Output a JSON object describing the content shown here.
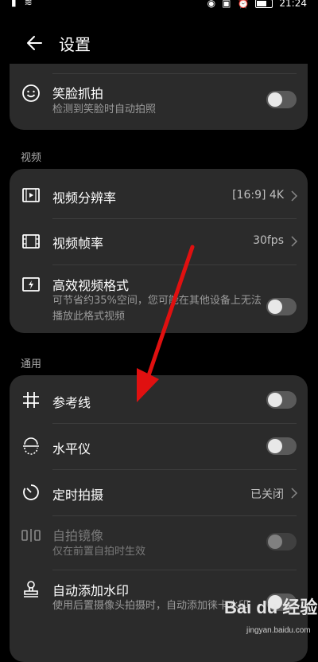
{
  "status_bar": {
    "time": "21:24"
  },
  "header": {
    "title": "设置"
  },
  "top_card": {
    "smile": {
      "label": "笑脸抓拍",
      "sub": "检测到笑脸时自动拍照"
    }
  },
  "sections": {
    "video": "视频",
    "general": "通用"
  },
  "video_card": {
    "resolution": {
      "label": "视频分辨率",
      "value": "[16:9] 4K"
    },
    "fps": {
      "label": "视频帧率",
      "value": "30fps"
    },
    "efficient": {
      "label": "高效视频格式",
      "sub": "可节省约35%空间，您可能在其他设备上无法播放此格式视频"
    }
  },
  "general_card": {
    "gridlines": {
      "label": "参考线"
    },
    "level": {
      "label": "水平仪"
    },
    "timer": {
      "label": "定时拍摄",
      "value": "已关闭"
    },
    "mirror": {
      "label": "自拍镜像",
      "sub": "仅在前置自拍时生效"
    },
    "watermark": {
      "label": "自动添加水印",
      "sub": "使用后置摄像头拍摄时，自动添加徕卡水印"
    }
  },
  "overlay": {
    "logo_text": "Bai du 经验",
    "site_text": "jingyan.baidu.com"
  },
  "colors": {
    "arrow": "#e01010",
    "card": "#2b2b2b",
    "background": "#000000"
  }
}
